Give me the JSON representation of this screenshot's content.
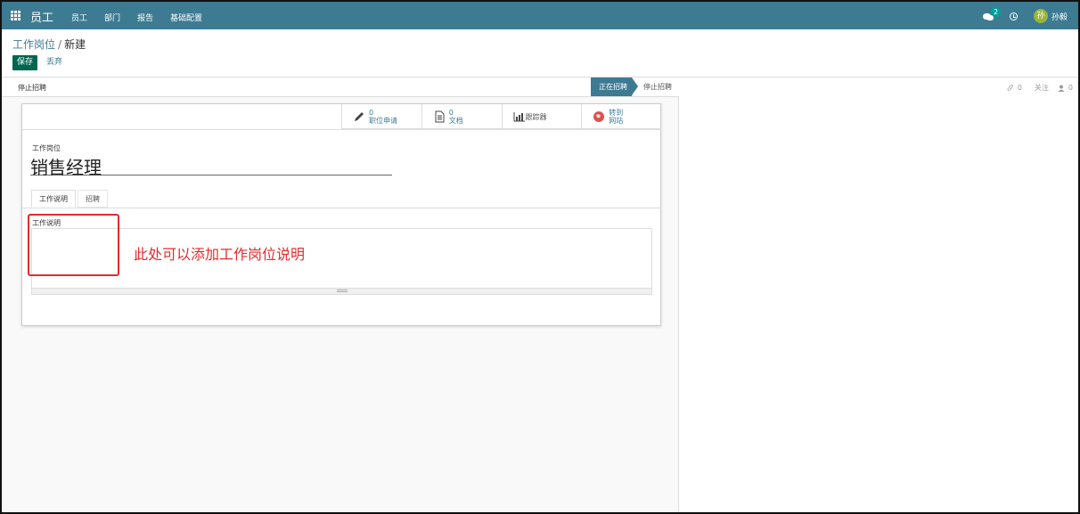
{
  "navbar": {
    "app_title": "员工",
    "menu": [
      "员工",
      "部门",
      "报告",
      "基础配置"
    ],
    "chat_badge": "2",
    "user_avatar": "孙",
    "user_name": "孙毅"
  },
  "control_panel": {
    "breadcrumb_parent": "工作岗位",
    "breadcrumb_sep": "/",
    "breadcrumb_current": "新建",
    "save_label": "保存",
    "discard_label": "丢弃"
  },
  "statusbar": {
    "stop_button": "停止招聘",
    "stage_active": "正在招聘",
    "stage_next": "停止招聘"
  },
  "smart_buttons": {
    "applications_count": "0",
    "applications_label": "职位申请",
    "documents_count": "0",
    "documents_label": "文档",
    "tracker_label": "跟踪器",
    "website_line1": "转到",
    "website_line2": "网站"
  },
  "form": {
    "title_label": "工作岗位",
    "title_value": "销售经理",
    "tabs": [
      "工作说明",
      "招聘"
    ],
    "description_label": "工作说明"
  },
  "annotation": {
    "text": "此处可以添加工作岗位说明",
    "color": "#e52b2b"
  },
  "chatter": {
    "attachments_count": "0",
    "follow_label": "关注",
    "followers_count": "0"
  },
  "colors": {
    "navbar": "#3d7b92",
    "primary_button": "#00664f",
    "badge": "#00a09d"
  }
}
